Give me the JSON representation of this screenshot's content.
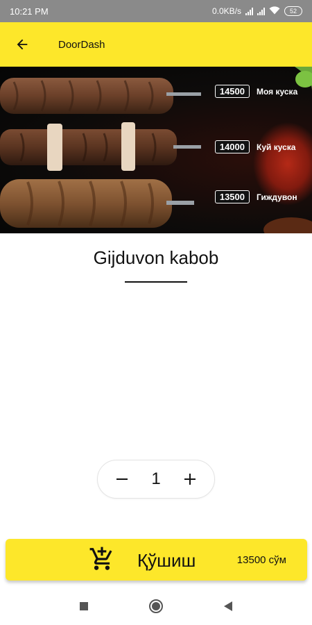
{
  "status_bar": {
    "time": "10:21 PM",
    "net_speed": "0.0KB/s",
    "battery": "52",
    "icons": [
      "signal-icon",
      "signal-icon",
      "wifi-icon",
      "battery-icon"
    ]
  },
  "app_bar": {
    "title": "DoorDash",
    "back_icon": "arrow-left-icon"
  },
  "hero": {
    "items": [
      {
        "price": "14500",
        "name": "Моя куска"
      },
      {
        "price": "14000",
        "name": "Куй куска"
      },
      {
        "price": "13500",
        "name": "Гиждувон"
      }
    ]
  },
  "product": {
    "title": "Gijduvon kabob"
  },
  "stepper": {
    "quantity": "1",
    "minus_icon": "minus-icon",
    "plus_icon": "plus-icon"
  },
  "add_to_cart": {
    "label": "Қўшиш",
    "price": "13500 сўм",
    "icon": "add-shopping-cart-icon"
  },
  "nav_bar": {
    "icons": [
      "recents-square-icon",
      "home-circle-icon",
      "back-triangle-icon"
    ]
  },
  "colors": {
    "accent": "#fde72a",
    "status_bar": "#8a8a8a"
  }
}
